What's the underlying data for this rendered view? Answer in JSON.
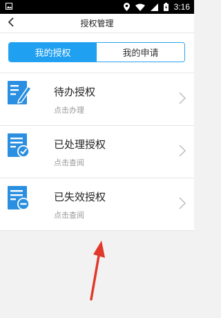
{
  "status_bar": {
    "time": "3:16",
    "icons": [
      "image-icon",
      "location-icon",
      "wifi-icon",
      "signal-icon",
      "battery-icon"
    ]
  },
  "header": {
    "title": "授权管理",
    "back_icon": "back-chevron-icon"
  },
  "tabs": [
    {
      "label": "我的授权",
      "active": true
    },
    {
      "label": "我的申请",
      "active": false
    }
  ],
  "items": [
    {
      "title": "待办授权",
      "subtitle": "点击办理",
      "icon": "edit-document-icon"
    },
    {
      "title": "已处理授权",
      "subtitle": "点击查阅",
      "icon": "checked-document-icon"
    },
    {
      "title": "已失效授权",
      "subtitle": "点击查阅",
      "icon": "expired-document-icon"
    }
  ],
  "colors": {
    "accent": "#1fa0f1",
    "annotation_arrow": "#e0392b"
  }
}
